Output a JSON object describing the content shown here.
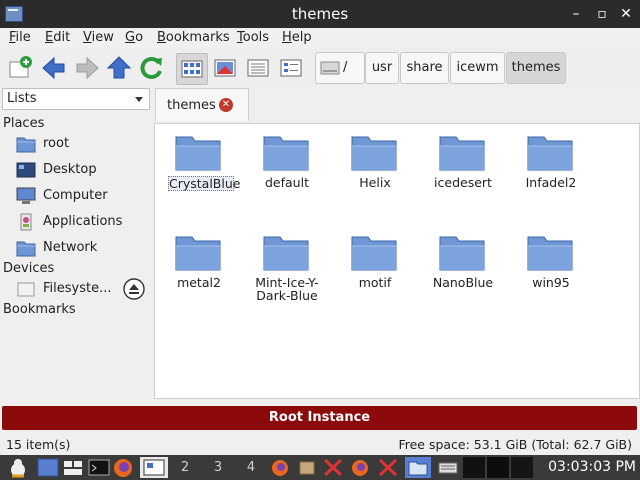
{
  "window": {
    "title": "themes"
  },
  "menu": [
    {
      "accel": "F",
      "rest": "ile"
    },
    {
      "accel": "E",
      "rest": "dit"
    },
    {
      "accel": "V",
      "rest": "iew"
    },
    {
      "accel": "G",
      "rest": "o"
    },
    {
      "accel": "B",
      "rest": "ookmarks"
    },
    {
      "accel": "T",
      "rest": "ools"
    },
    {
      "accel": "H",
      "rest": "elp"
    }
  ],
  "toolbar": {
    "icons": [
      "new-tab-icon",
      "back-icon",
      "forward-icon",
      "up-icon",
      "reload-icon",
      "icon-view-icon",
      "thumbnail-view-icon",
      "compact-view-icon",
      "detail-view-icon"
    ],
    "breadcrumbs": [
      "/",
      "usr",
      "share",
      "icewm",
      "themes"
    ]
  },
  "sidebar": {
    "mode": "Lists",
    "places_heading": "Places",
    "places": [
      {
        "label": "root",
        "icon": "home-folder-icon"
      },
      {
        "label": "Desktop",
        "icon": "desktop-icon"
      },
      {
        "label": "Computer",
        "icon": "computer-icon"
      },
      {
        "label": "Applications",
        "icon": "applications-icon"
      },
      {
        "label": "Network",
        "icon": "network-folder-icon"
      }
    ],
    "devices_heading": "Devices",
    "devices": [
      {
        "label": "Filesyste...",
        "icon": "drive-icon"
      }
    ],
    "bookmarks_heading": "Bookmarks"
  },
  "tab": {
    "label": "themes"
  },
  "files": [
    {
      "name": "CrystalBlue",
      "selected": true
    },
    {
      "name": "default"
    },
    {
      "name": "Helix"
    },
    {
      "name": "icedesert"
    },
    {
      "name": "Infadel2"
    },
    {
      "name": "metal2"
    },
    {
      "name": "Mint-Ice-Y-Dark-Blue",
      "lines": [
        "Mint-Ice-Y-",
        "Dark-Blue"
      ]
    },
    {
      "name": "motif"
    },
    {
      "name": "NanoBlue"
    },
    {
      "name": "win95"
    }
  ],
  "banner": "Root Instance",
  "status": {
    "count": "15 item(s)",
    "free_space": "Free space: 53.1 GiB (Total: 62.7 GiB)"
  },
  "taskbar": {
    "workspaces": [
      "2",
      "3",
      "4"
    ],
    "clock": "03:03:03 PM"
  },
  "colors": {
    "folder": "#6f97d6",
    "banner": "#8c0a0a",
    "taskbar": "#3a3a3a"
  }
}
